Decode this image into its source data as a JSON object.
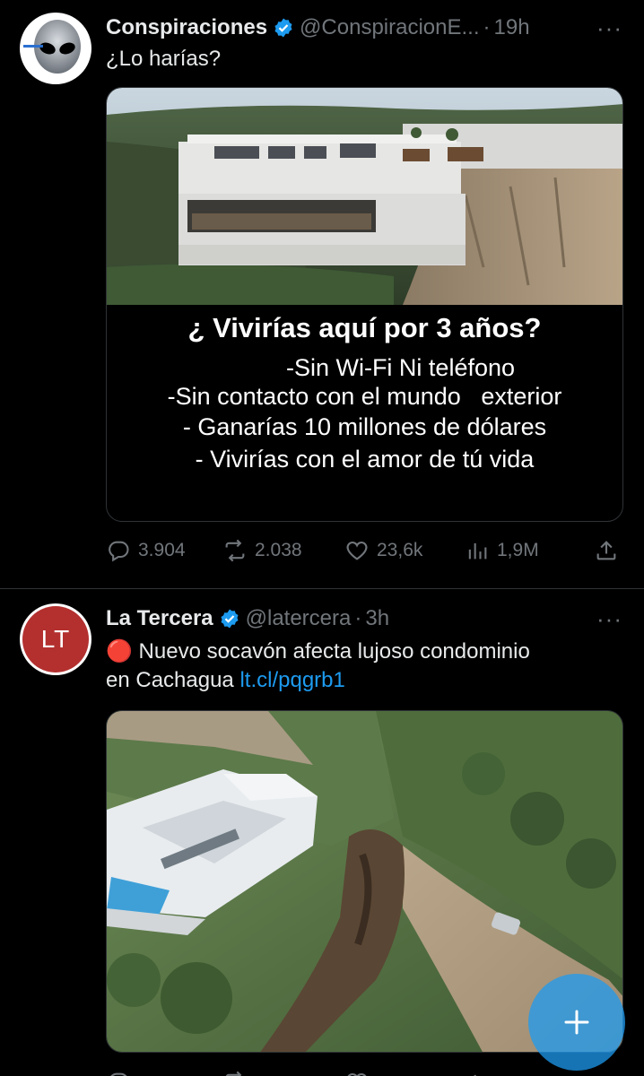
{
  "tweet1": {
    "name": "Conspiraciones",
    "handle": "@ConspiracionE...",
    "dot": "·",
    "time": "19h",
    "more": "···",
    "text": "¿Lo harías?",
    "image_lines": {
      "title": "¿ Vivirías aquí por 3 años?",
      "line1": "-Sin Wi-Fi Ni teléfono",
      "line2": "-Sin contacto con el mundo   exterior",
      "line3": "- Ganarías 10 millones de dólares",
      "line4": "- Vivirías con el amor de tú vida"
    },
    "replies": "3.904",
    "reposts": "2.038",
    "likes": "23,6k",
    "views": "1,9M"
  },
  "tweet2": {
    "avatar_text": "LT",
    "name": "La Tercera",
    "handle": "@latercera",
    "dot": "·",
    "time": "3h",
    "more": "···",
    "emoji": "🔴",
    "text_part1": " Nuevo socavón afecta lujoso condominio",
    "text_part2": "en Cachagua ",
    "link": "lt.cl/pqgrb1"
  },
  "colors": {
    "background": "#000000",
    "text": "#e7e9ea",
    "secondary": "#71767b",
    "accent": "#1d9bf0",
    "verified": "#1d9bf0",
    "lt_avatar": "#b3302f"
  },
  "fab_icon": "plus-icon"
}
